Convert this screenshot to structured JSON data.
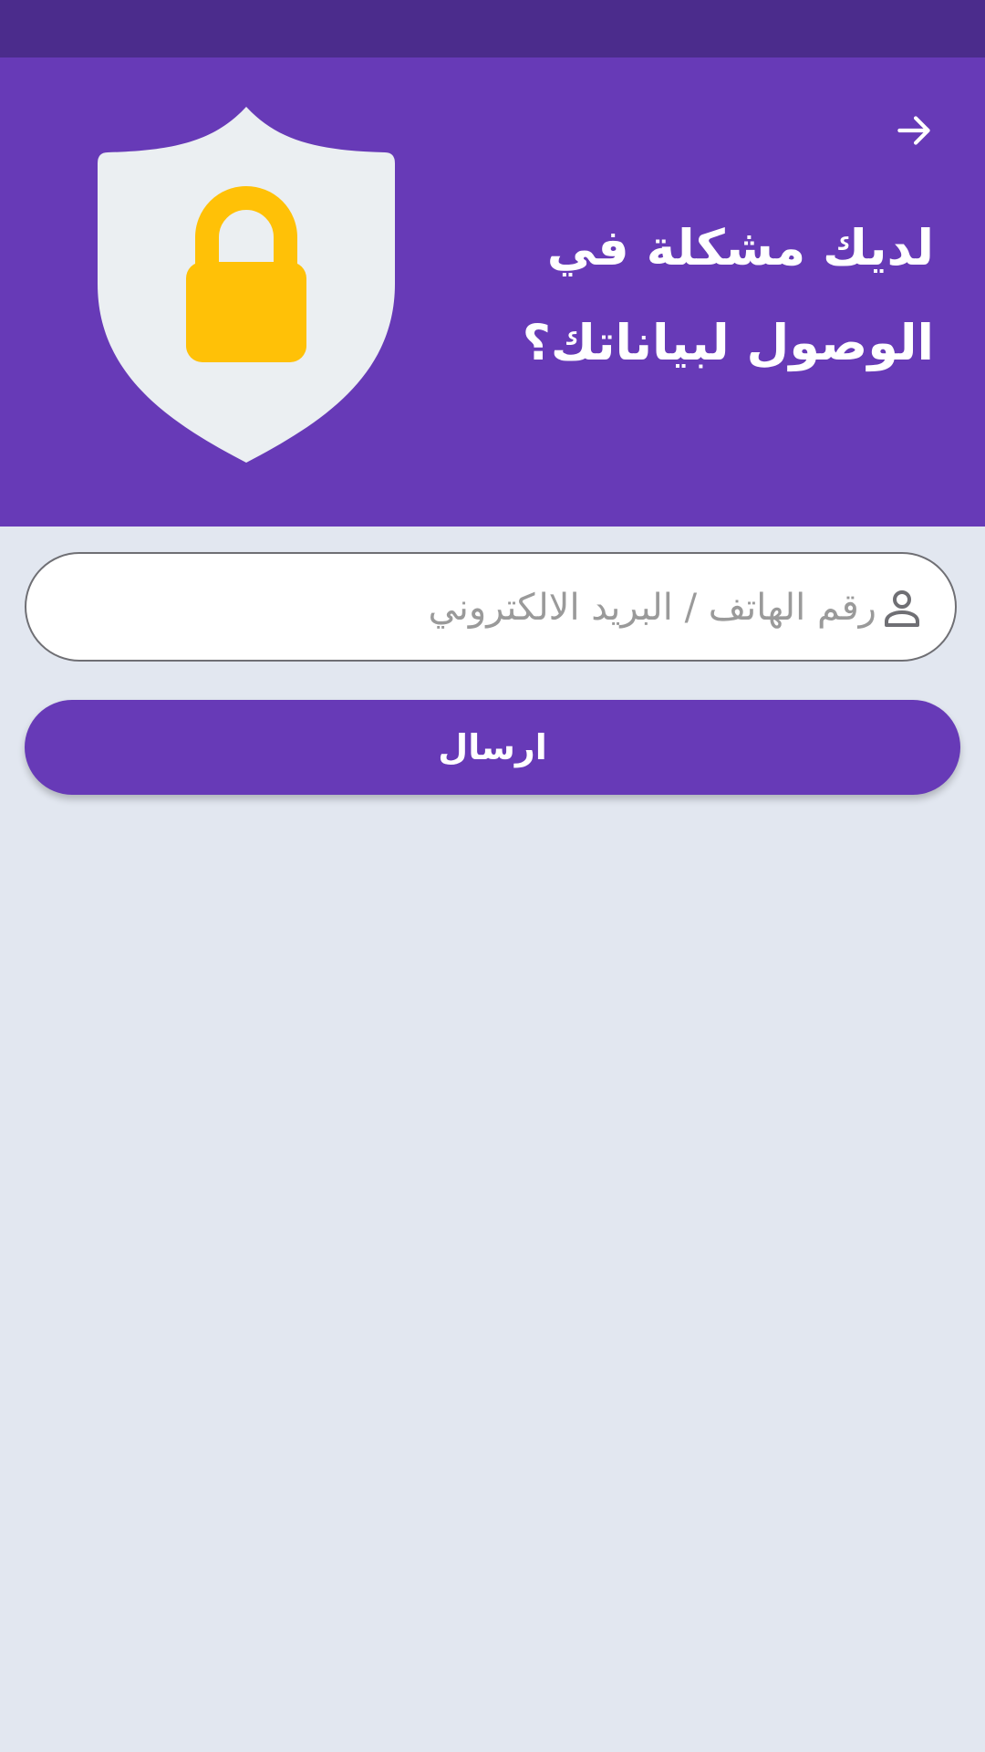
{
  "status_bar": {},
  "header": {
    "back_icon": "arrow-right-icon",
    "title_line1": "لديك مشكلة في",
    "title_line2": "الوصول لبياناتك؟",
    "illustration": "shield-lock-icon"
  },
  "form": {
    "identifier_placeholder": "رقم الهاتف / البريد الالكتروني",
    "identifier_value": "",
    "identifier_icon": "user-icon",
    "submit_label": "ارسال"
  },
  "colors": {
    "primary": "#673ab7",
    "status_bar": "#4b2c8c",
    "background": "#e2e7f0",
    "lock": "#ffc107",
    "shield": "#ebeff2"
  }
}
